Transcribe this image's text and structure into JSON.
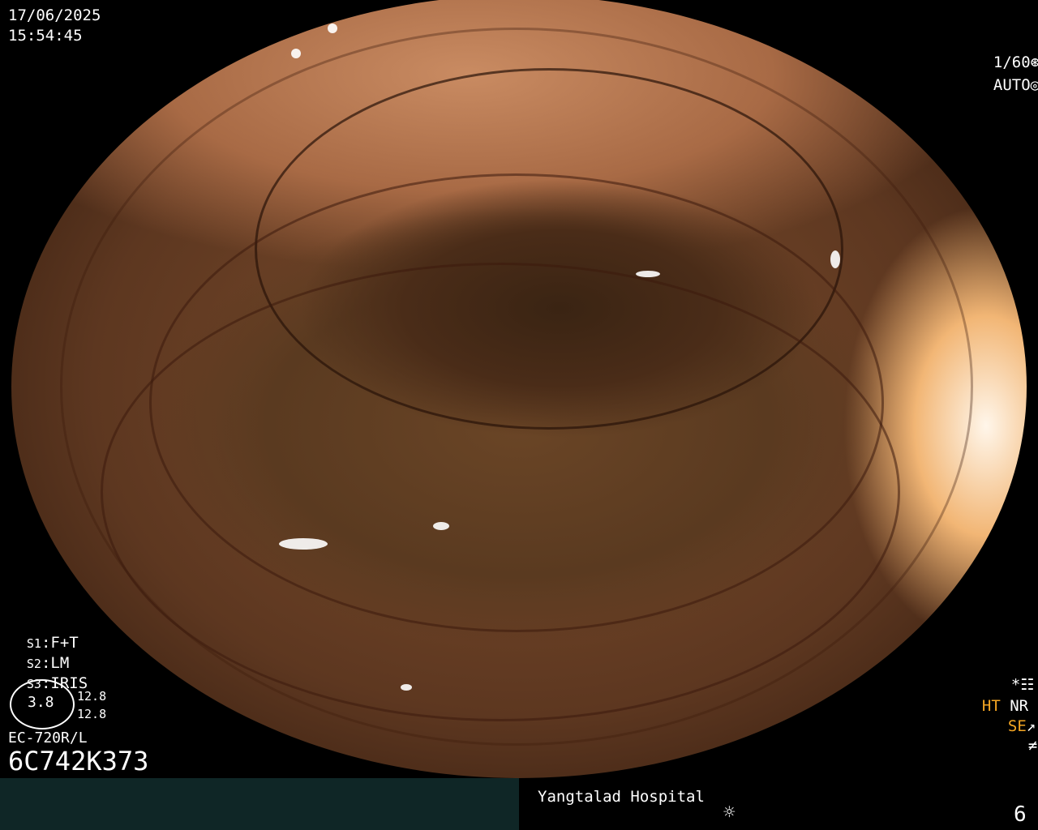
{
  "datetime": {
    "date": "17/06/2025",
    "time": "15:54:45"
  },
  "shutter": {
    "speed": "1/60",
    "speed_icon": "shutter-icon",
    "mode": "AUTO",
    "mode_icon": "iris-icon"
  },
  "settings": [
    {
      "key": "S1",
      "value": "F+T"
    },
    {
      "key": "S2",
      "value": "LM"
    },
    {
      "key": "S3",
      "value": "IRIS"
    }
  ],
  "gauge": {
    "center_value": "3.8",
    "upper_value": "12.8",
    "lower_value": "12.8"
  },
  "scope": {
    "model": "EC-720R/L",
    "serial": "6C742K373"
  },
  "right_status": {
    "asterisk": "*",
    "ht": "HT",
    "nr": "NR",
    "se": "SE",
    "accent_color": "#f5a623"
  },
  "footer": {
    "hospital": "Yangtalad Hospital",
    "light_icon": "brightness-icon",
    "number": "6"
  }
}
